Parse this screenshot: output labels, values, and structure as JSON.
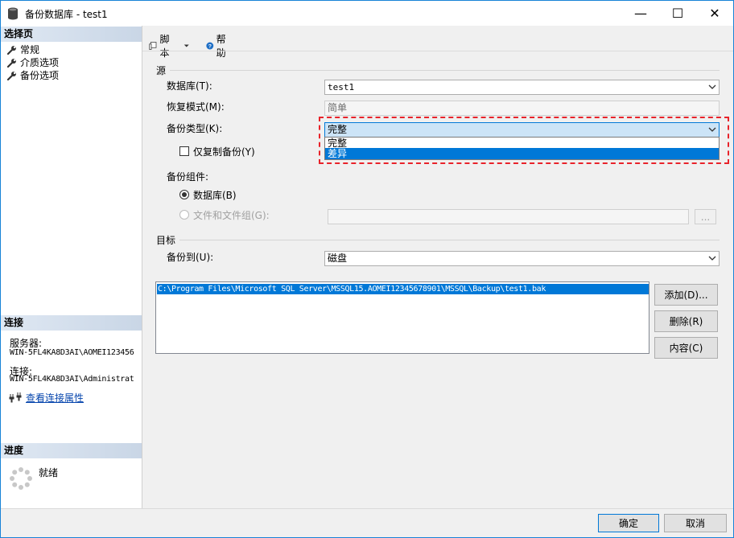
{
  "window": {
    "title": "备份数据库 - test1",
    "controls": {
      "minimize": "—",
      "maximize": "☐",
      "close": "✕"
    }
  },
  "left_pane": {
    "select_page_header": "选择页",
    "pages": [
      {
        "label": "常规",
        "icon": "wrench-icon"
      },
      {
        "label": "介质选项",
        "icon": "wrench-icon"
      },
      {
        "label": "备份选项",
        "icon": "wrench-icon"
      }
    ],
    "connection_header": "连接",
    "server_label": "服务器:",
    "server_value": "WIN-5FL4KA8D3AI\\AOMEI123456",
    "connection_label": "连接:",
    "connection_value": "WIN-5FL4KA8D3AI\\Administrat",
    "view_connection_props": "查看连接属性",
    "progress_header": "进度",
    "progress_status": "就绪"
  },
  "toolbar": {
    "script_label": "脚本",
    "help_label": "帮助"
  },
  "source": {
    "group_label": "源",
    "database_label": "数据库(T):",
    "database_value": "test1",
    "recovery_label": "恢复模式(M):",
    "recovery_value": "简单",
    "backup_type_label": "备份类型(K):",
    "backup_type_value": "完整",
    "backup_type_options": [
      "完整",
      "差异"
    ],
    "backup_type_highlighted": "差异",
    "copy_only_label": "仅复制备份(Y)",
    "copy_only_checked": false,
    "component_label": "备份组件:",
    "component_database": "数据库(B)",
    "component_files": "文件和文件组(G):",
    "files_browse": "..."
  },
  "destination": {
    "group_label": "目标",
    "backup_to_label": "备份到(U):",
    "backup_to_value": "磁盘",
    "paths": [
      "C:\\Program Files\\Microsoft SQL Server\\MSSQL15.AOMEI12345678901\\MSSQL\\Backup\\test1.bak"
    ],
    "add_button": "添加(D)...",
    "remove_button": "删除(R)",
    "contents_button": "内容(C)"
  },
  "footer": {
    "ok_button": "确定",
    "cancel_button": "取消"
  },
  "colors": {
    "accent": "#0078d7",
    "highlight_dashes": "#e8232a",
    "section_header": "#c9d6e6"
  }
}
